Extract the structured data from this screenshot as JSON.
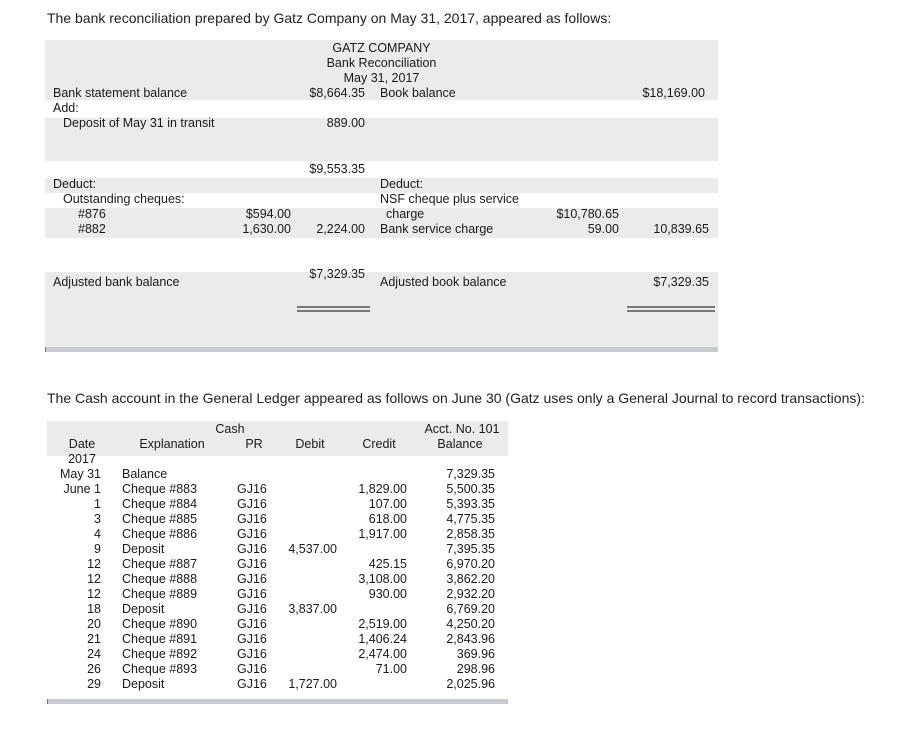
{
  "intro1": "The bank reconciliation prepared by Gatz Company on May 31, 2017, appeared as follows:",
  "intro2": "The Cash account in the General Ledger appeared as follows on June 30 (Gatz uses only a General Journal to record transactions):",
  "rec": {
    "company": "GATZ COMPANY",
    "title": "Bank Reconciliation",
    "date": "May 31, 2017",
    "bank_statement_label": "Bank statement balance",
    "bank_statement_amount": "$8,664.35",
    "book_balance_label": "Book balance",
    "book_balance_amount": "$18,169.00",
    "add_label": "Add:",
    "deposit_transit_label": "Deposit of May 31 in transit",
    "deposit_transit_amount": "889.00",
    "subtotal": "$9,553.35",
    "deduct_left": "Deduct:",
    "outstanding_label": "Outstanding cheques:",
    "cheque1_num": "#876",
    "cheque1_amt": "$594.00",
    "cheque2_num": "#882",
    "cheque2_amt": "1,630.00",
    "outstanding_total": "2,224.00",
    "deduct_right": "Deduct:",
    "nsf_label_1": "NSF cheque plus service",
    "nsf_label_2": "charge",
    "nsf_amt": "$10,780.65",
    "service_label": "Bank service charge",
    "service_amt": "59.00",
    "book_deduct_total": "10,839.65",
    "adj_bank_label": "Adjusted bank balance",
    "adj_bank_amt": "$7,329.35",
    "adj_book_label": "Adjusted book balance",
    "adj_book_amt": "$7,329.35"
  },
  "ledger": {
    "title": "Cash",
    "acct": "Acct. No. 101",
    "headers": {
      "date": "Date",
      "explanation": "Explanation",
      "pr": "PR",
      "debit": "Debit",
      "credit": "Credit",
      "balance": "Balance"
    },
    "year": "2017",
    "rows": [
      {
        "date": "May 31",
        "exp": "Balance",
        "pr": "",
        "debit": "",
        "credit": "",
        "balance": "7,329.35"
      },
      {
        "date": "June 1",
        "exp": "Cheque #883",
        "pr": "GJ16",
        "debit": "",
        "credit": "1,829.00",
        "balance": "5,500.35"
      },
      {
        "date": "1",
        "exp": "Cheque #884",
        "pr": "GJ16",
        "debit": "",
        "credit": "107.00",
        "balance": "5,393.35"
      },
      {
        "date": "3",
        "exp": "Cheque #885",
        "pr": "GJ16",
        "debit": "",
        "credit": "618.00",
        "balance": "4,775.35"
      },
      {
        "date": "4",
        "exp": "Cheque #886",
        "pr": "GJ16",
        "debit": "",
        "credit": "1,917.00",
        "balance": "2,858.35"
      },
      {
        "date": "9",
        "exp": "Deposit",
        "pr": "GJ16",
        "debit": "4,537.00",
        "credit": "",
        "balance": "7,395.35"
      },
      {
        "date": "12",
        "exp": "Cheque #887",
        "pr": "GJ16",
        "debit": "",
        "credit": "425.15",
        "balance": "6,970.20"
      },
      {
        "date": "12",
        "exp": "Cheque #888",
        "pr": "GJ16",
        "debit": "",
        "credit": "3,108.00",
        "balance": "3,862.20"
      },
      {
        "date": "12",
        "exp": "Cheque #889",
        "pr": "GJ16",
        "debit": "",
        "credit": "930.00",
        "balance": "2,932.20"
      },
      {
        "date": "18",
        "exp": "Deposit",
        "pr": "GJ16",
        "debit": "3,837.00",
        "credit": "",
        "balance": "6,769.20"
      },
      {
        "date": "20",
        "exp": "Cheque #890",
        "pr": "GJ16",
        "debit": "",
        "credit": "2,519.00",
        "balance": "4,250.20"
      },
      {
        "date": "21",
        "exp": "Cheque #891",
        "pr": "GJ16",
        "debit": "",
        "credit": "1,406.24",
        "balance": "2,843.96"
      },
      {
        "date": "24",
        "exp": "Cheque #892",
        "pr": "GJ16",
        "debit": "",
        "credit": "2,474.00",
        "balance": "369.96"
      },
      {
        "date": "26",
        "exp": "Cheque #893",
        "pr": "GJ16",
        "debit": "",
        "credit": "71.00",
        "balance": "298.96"
      },
      {
        "date": "29",
        "exp": "Deposit",
        "pr": "GJ16",
        "debit": "1,727.00",
        "credit": "",
        "balance": "2,025.96"
      }
    ]
  }
}
